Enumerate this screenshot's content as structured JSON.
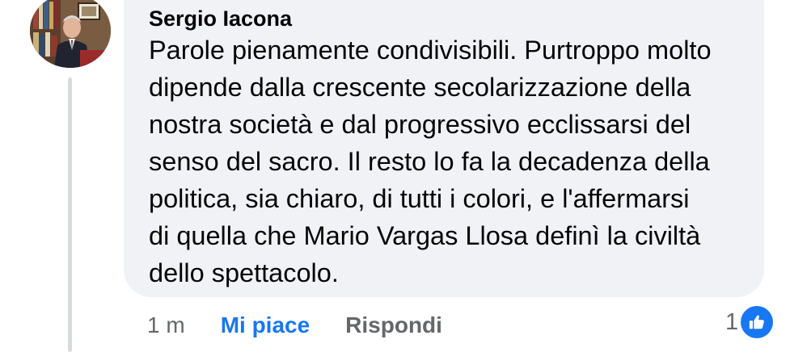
{
  "comment": {
    "author": "Sergio Iacona",
    "text_lines": [
      "Parole pienamente condivisibili. Purtroppo molto",
      "dipende dalla crescente secolarizzazione della",
      "nostra società e dal progressivo ecclissarsi del",
      "senso del sacro. Il resto lo fa la decadenza della",
      "politica, sia chiaro, di tutti i colori, e l'affermarsi",
      "di quella che Mario Vargas Llosa definì la civiltà",
      "dello spettacolo."
    ]
  },
  "actions": {
    "timestamp": "1 m",
    "like_label": "Mi piace",
    "reply_label": "Rispondi"
  },
  "reactions": {
    "count": "1",
    "icon": "thumbs-up-icon"
  },
  "colors": {
    "accent": "#1877f2",
    "bubble": "#f0f2f5",
    "secondary_text": "#65676b",
    "primary_text": "#050505"
  }
}
